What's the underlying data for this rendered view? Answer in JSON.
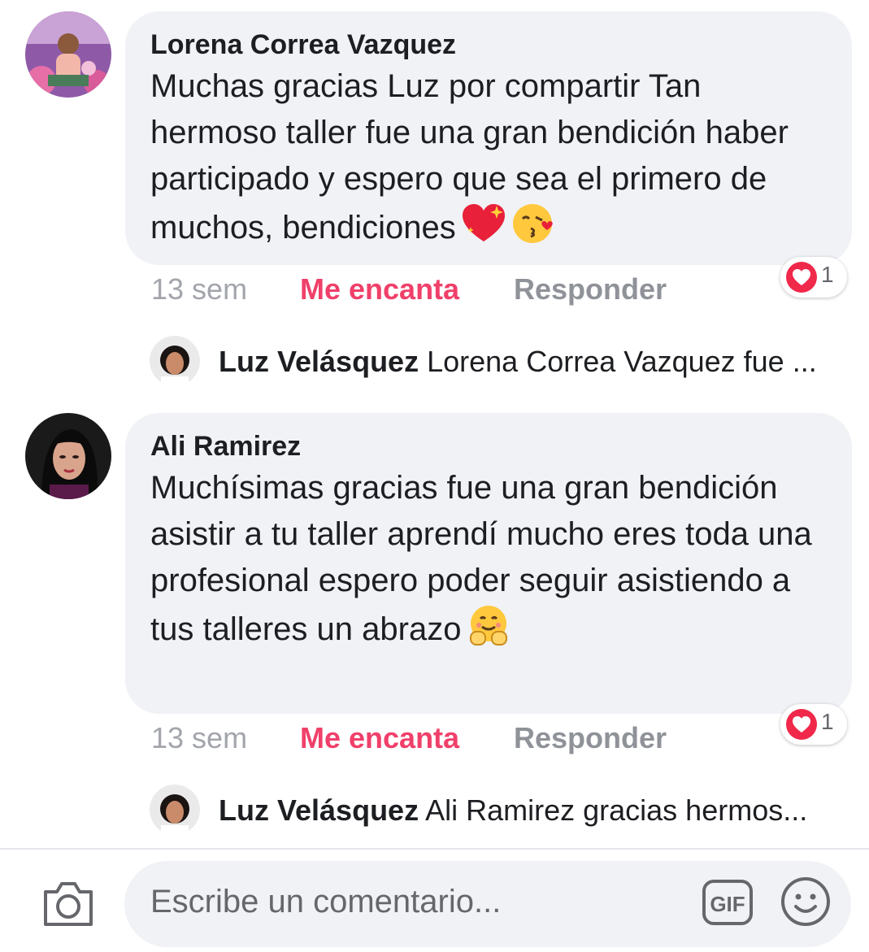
{
  "comments": [
    {
      "author": "Lorena Correa Vazquez",
      "text": "Muchas gracias Luz por compartir Tan hermoso taller fue una gran bendición haber participado y espero que sea el primero de muchos, bendiciones",
      "emojis": [
        "sparkling-heart",
        "kissing-face"
      ],
      "time": "13 sem",
      "love_label": "Me encanta",
      "reply_label": "Responder",
      "reaction_count": "1",
      "reaction_icon": "love-heart-icon",
      "reply_preview": {
        "author": "Luz Velásquez",
        "text": "Lorena Correa Vazquez fue ..."
      }
    },
    {
      "author": "Ali Ramirez",
      "text": "Muchísimas gracias fue una gran bendición asistir a tu taller aprendí mucho eres toda una profesional espero poder seguir asistiendo a tus talleres un abrazo",
      "emojis": [
        "hugging-face"
      ],
      "time": "13 sem",
      "love_label": "Me encanta",
      "reply_label": "Responder",
      "reaction_count": "1",
      "reaction_icon": "love-heart-icon",
      "reply_preview": {
        "author": "Luz Velásquez",
        "text": "Ali Ramirez gracias hermos..."
      }
    }
  ],
  "composer": {
    "placeholder": "Escribe un comentario...",
    "icons": [
      "camera-icon",
      "gif-icon",
      "emoji-smile-icon"
    ],
    "gif_label": "GIF"
  },
  "colors": {
    "love": "#f0406a",
    "bubble": "#f0f2f5",
    "muted": "#a2a5ab"
  }
}
